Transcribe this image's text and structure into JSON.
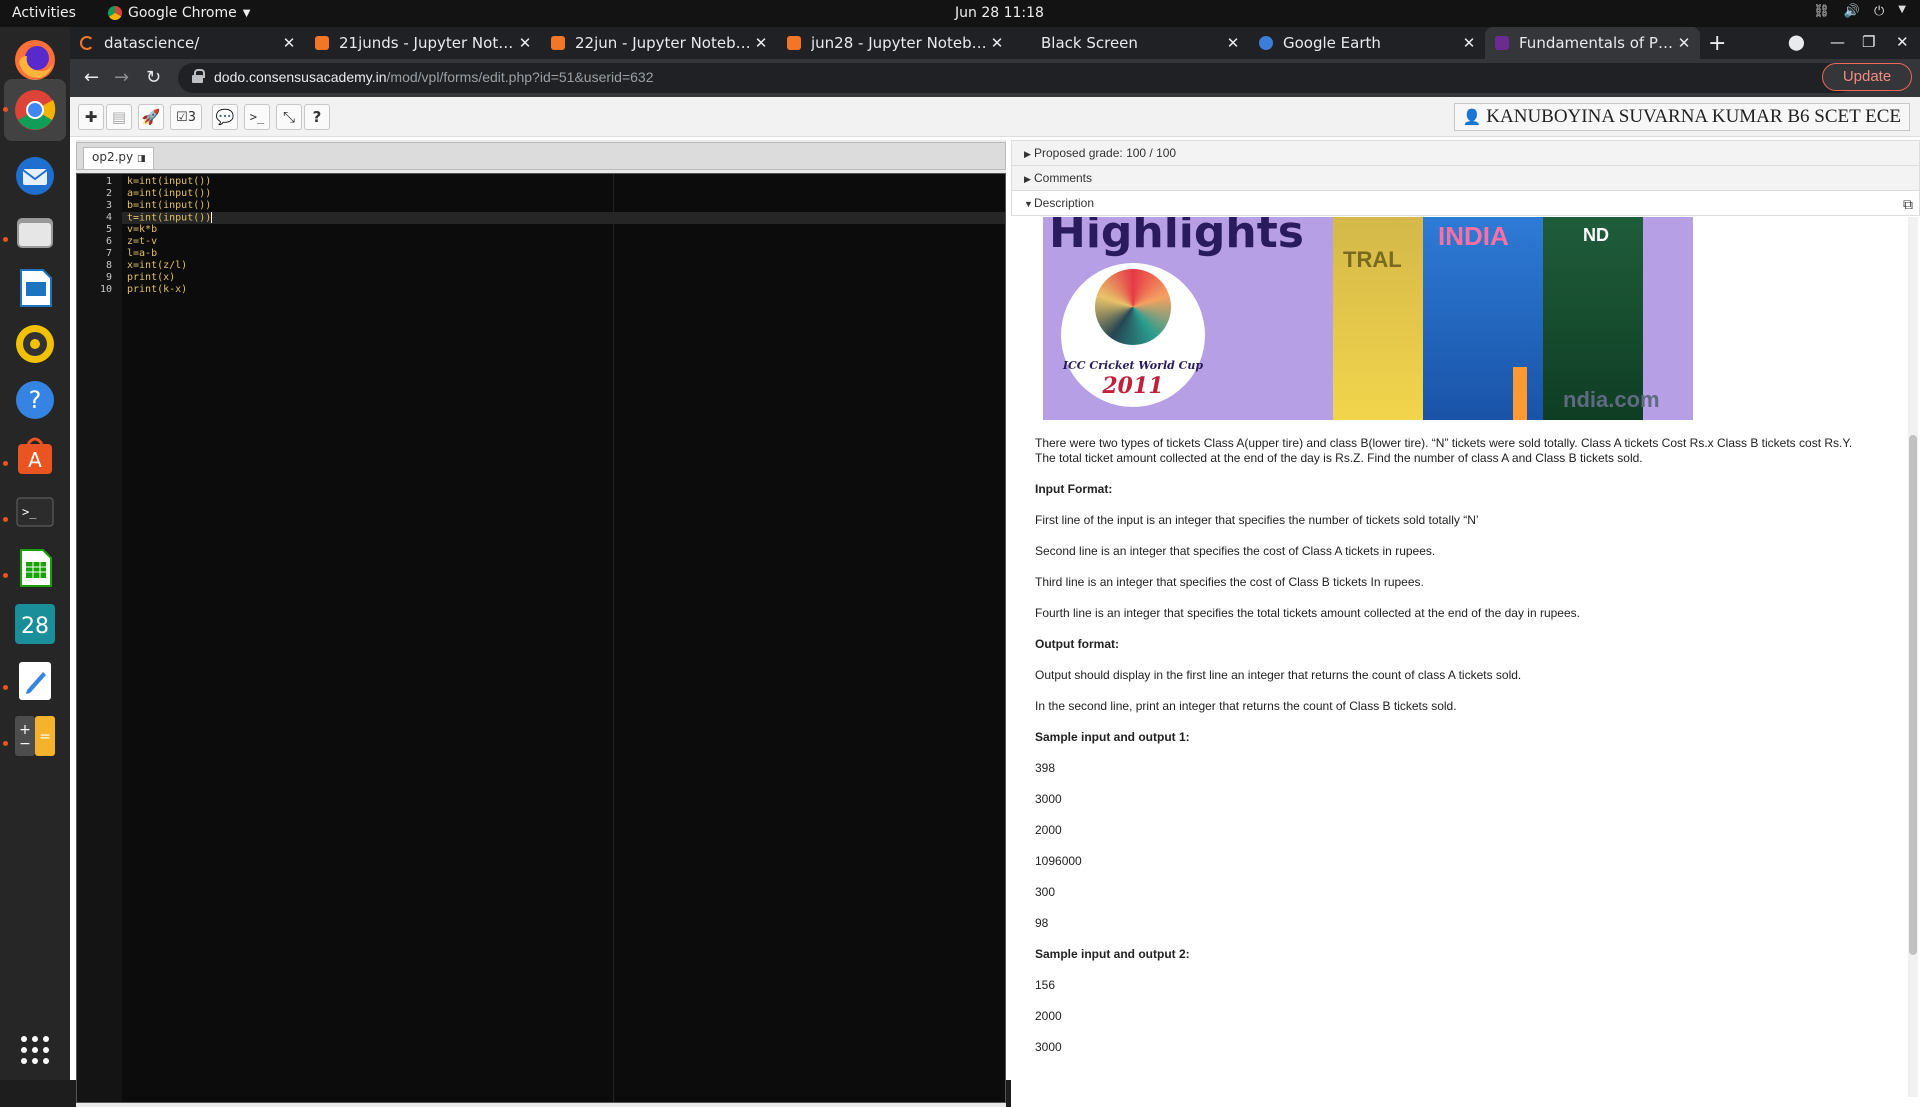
{
  "topbar": {
    "activities": "Activities",
    "app_name": "Google Chrome",
    "clock": "Jun 28  11:18"
  },
  "dock": {
    "apps": [
      "Firefox",
      "Google Chrome",
      "Thunderbird",
      "Files",
      "LibreOffice Impress",
      "Rhythmbox",
      "Help",
      "Ubuntu Software",
      "Terminal",
      "LibreOffice Calc",
      "Calendar",
      "Text Editor",
      "Calculator",
      "Show Applications"
    ],
    "calendar_day": "28"
  },
  "tabs": [
    {
      "title": "datascience/",
      "icon": "jupyter-icon",
      "color": "#f37626"
    },
    {
      "title": "21junds - Jupyter Notebook",
      "icon": "notebook-icon",
      "color": "#f37626"
    },
    {
      "title": "22jun - Jupyter Notebook",
      "icon": "notebook-icon",
      "color": "#f37626"
    },
    {
      "title": "jun28 - Jupyter Notebook",
      "icon": "notebook-icon",
      "color": "#f37626"
    },
    {
      "title": "Black Screen",
      "icon": "",
      "color": ""
    },
    {
      "title": "Google Earth",
      "icon": "earth-icon",
      "color": "#3b7dd8"
    },
    {
      "title": "Fundamentals of Python",
      "icon": "moodle-icon",
      "color": "#6b2c91"
    }
  ],
  "omnibar": {
    "url_host": "dodo.consensusacademy.in",
    "url_path": "/mod/vpl/forms/edit.php?id=51&userid=632",
    "update_label": "Update"
  },
  "toolbar": {
    "evaluate_count": "3",
    "user": "KANUBOYINA SUVARNA KUMAR B6 SCET ECE"
  },
  "editor": {
    "filename": "op2.py",
    "lines": [
      "k=int(input())",
      "a=int(input())",
      "b=int(input())",
      "t=int(input())",
      "v=k*b",
      "z=t-v",
      "l=a-b",
      "x=int(z/l)",
      "print(x)",
      "print(k-x)"
    ]
  },
  "panel": {
    "grade": "Proposed grade: 100 / 100",
    "comments": "Comments",
    "description": "Description"
  },
  "banner": {
    "headline": "Highlights",
    "logo_line1": "ICC Cricket World Cup",
    "logo_line2": "2011",
    "t_india": "INDIA",
    "t_aus": "TRAL",
    "t_nd": "ND",
    "watermark": "ndia.com"
  },
  "description": {
    "intro1": "There were two types of tickets Class A(upper tire) and class B(lower tire). “N” tickets were sold totally. Class A tickets Cost Rs.x Class B tickets cost Rs.Y.",
    "intro2": "The total ticket amount collected at the end of the day is Rs.Z. Find the number of class A and Class B tickets sold.",
    "input_format_label": "Input Format:",
    "input1": "First line of the input is an integer that specifies the number of tickets sold totally “N’",
    "input2": "Second line is an integer that specifies the cost of Class A tickets in rupees.",
    "input3": "Third line is an integer that specifies the cost of Class B tickets In rupees.",
    "input4": "Fourth line is an integer that specifies the total tickets amount collected at the end of the day in rupees.",
    "output_format_label": "Output format:",
    "output1": "Output should display in the first line an integer that returns the count of class A tickets sold.",
    "output2": "In the second line, print an integer that returns the count of Class B tickets sold.",
    "sample1_label": "Sample input and output 1:",
    "sample1": [
      "398",
      "3000",
      "2000",
      "1096000",
      "300",
      "98"
    ],
    "sample2_label": "Sample input and output 2:",
    "sample2": [
      "156",
      "2000",
      "3000"
    ]
  }
}
